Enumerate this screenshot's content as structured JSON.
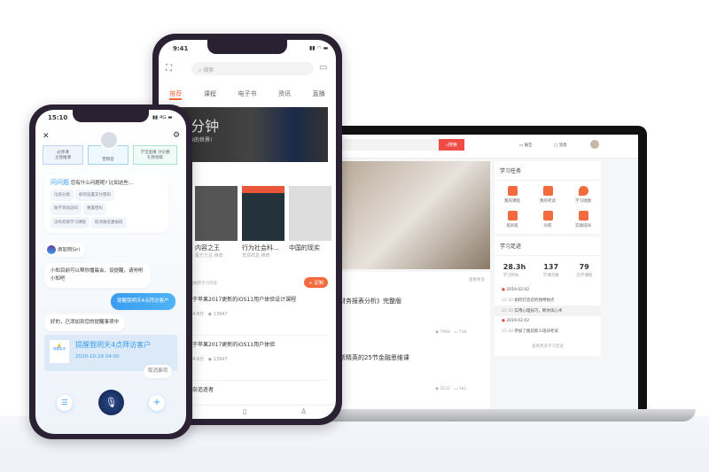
{
  "laptop": {
    "search_button": "搜索",
    "nav": [
      "报告",
      "消息"
    ],
    "tasks": {
      "title": "学习任务",
      "items": [
        "我的课程",
        "我的考试",
        "学习地图",
        "培训班",
        "问卷",
        "实践培训"
      ]
    },
    "footprint": {
      "title": "学习足迹",
      "stats": [
        {
          "value": "28.3h",
          "label": "学习时长"
        },
        {
          "value": "137",
          "label": "学课次数"
        },
        {
          "value": "79",
          "label": "已学课程"
        }
      ],
      "timeline": [
        {
          "date": "2019.02.02",
          "entries": [
            {
              "time": "22:30",
              "text": "如何打造您的独特视点"
            },
            {
              "time": "22:30",
              "text": "实用心理技巧，教你读心术"
            }
          ]
        },
        {
          "date": "2019.02.02",
          "entries": [
            {
              "time": "22:30",
              "text": "参加了图前新人培训考试"
            }
          ]
        }
      ],
      "more": "查看更多学习足迹"
    },
    "list": {
      "more": "查看更多",
      "items": [
        {
          "title": "财务报表分析》完整版",
          "views": "7968",
          "comments": "738"
        },
        {
          "title": "斯精英的25节金融思维课",
          "views": "5632",
          "comments": "181"
        }
      ]
    }
  },
  "phone_mid": {
    "time": "9:41",
    "search_placeholder": "搜索",
    "tabs": [
      "推荐",
      "课程",
      "电子书",
      "资讯",
      "直播"
    ],
    "banner": {
      "title": "天5分钟",
      "subtitle": "懂这个复杂的世界!"
    },
    "books": [
      {
        "title": "信集",
        "author": ""
      },
      {
        "title": "内容之王",
        "author": "蔡方方总 推荐"
      },
      {
        "title": "行为社会科...",
        "author": "李源祥总 推荐"
      },
      {
        "title": "中国的现实",
        "author": ""
      }
    ],
    "rec_hint": "根据你的兴趣推荐学习内容",
    "customize": "+ 定制",
    "courses": [
      {
        "title": "关于苹果2017更新的iOS11用户体验设计课程",
        "rating": "4.6分",
        "views": "13947"
      },
      {
        "title": "关于苹果2017更新的iOS11用户体验",
        "rating": "4.6分",
        "views": "13947"
      },
      {
        "title": "莫奈追逐者",
        "rating": "",
        "views": ""
      }
    ]
  },
  "phone_left": {
    "time": "15:10",
    "signal": "4G",
    "top_cards": [
      [
        "必修课",
        "主管推课"
      ],
      [
        "营销官"
      ],
      [
        "学堂直播 讨论圈",
        "礼物领取"
      ]
    ],
    "faq": {
      "title": "问问题",
      "prompt": "您有什么问题呢? 比如这些...",
      "chips": [
        "垃圾分类",
        "如何设置支付密码",
        "收不到动态码",
        "重置密码",
        "没有权限学习课程",
        "取消报名重报班"
      ]
    },
    "siri": "添加到Siri",
    "messages": [
      {
        "from": "bot",
        "text": "小知目前可以帮你播晨会、设提醒，请吩咐小知吧"
      },
      {
        "from": "user",
        "text": "提醒我明天4点拜访客户"
      },
      {
        "from": "bot",
        "text": "好的，已添加到您的提醒事项中"
      }
    ],
    "reminder": {
      "label": "提醒事项",
      "title": "提醒我明天4点拜访客户",
      "datetime": "2020-10-29 04:00",
      "cancel": "取消事项"
    }
  },
  "colors": {
    "accent_orange": "#f36a3f",
    "laptop_red": "#f04b45",
    "chat_blue": "#3a9cf0"
  }
}
